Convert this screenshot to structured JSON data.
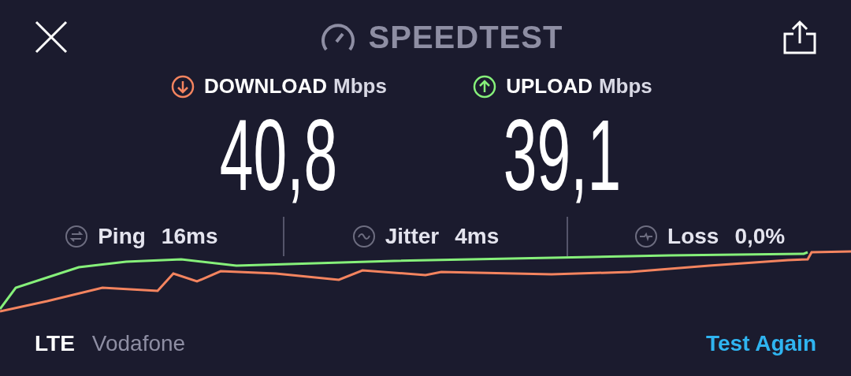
{
  "title": "SPEEDTEST",
  "results": [
    {
      "kind": "download",
      "label": "DOWNLOAD",
      "unit": "Mbps",
      "value": "40,8",
      "color": "#f4845f"
    },
    {
      "kind": "upload",
      "label": "UPLOAD",
      "unit": "Mbps",
      "value": "39,1",
      "color": "#86f07a"
    }
  ],
  "stats": [
    {
      "kind": "ping",
      "label": "Ping",
      "value": "16ms"
    },
    {
      "kind": "jitter",
      "label": "Jitter",
      "value": "4ms"
    },
    {
      "kind": "loss",
      "label": "Loss",
      "value": "0,0%"
    }
  ],
  "footer": {
    "network": "LTE",
    "carrier": "Vodafone",
    "action": "Test Again"
  }
}
